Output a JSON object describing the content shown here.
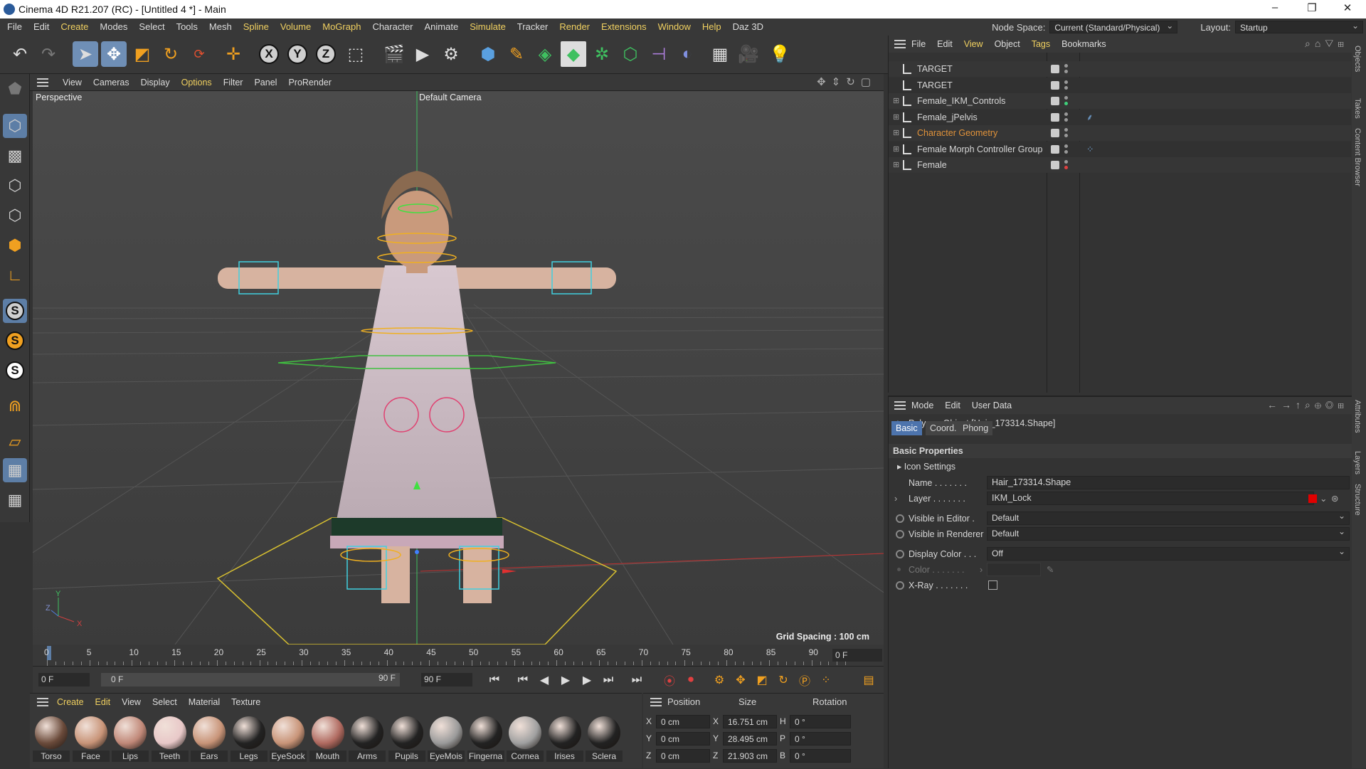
{
  "window": {
    "title": "Cinema 4D R21.207 (RC) - [Untitled 4 *] - Main",
    "min": "–",
    "max": "❐",
    "close": "✕"
  },
  "menu": [
    "File",
    "Edit",
    "Create",
    "Modes",
    "Select",
    "Tools",
    "Mesh",
    "Spline",
    "Volume",
    "MoGraph",
    "Character",
    "Animate",
    "Simulate",
    "Tracker",
    "Render",
    "Extensions",
    "Window",
    "Help",
    "Daz 3D"
  ],
  "menu_highlight": [
    "Create",
    "Spline",
    "Volume",
    "MoGraph",
    "Simulate",
    "Render",
    "Extensions",
    "Window",
    "Help"
  ],
  "node_space": {
    "label": "Node Space:",
    "value": "Current (Standard/Physical)"
  },
  "layout": {
    "label": "Layout:",
    "value": "Startup"
  },
  "viewport": {
    "menu": [
      "View",
      "Cameras",
      "Display",
      "Options",
      "Filter",
      "Panel",
      "ProRender"
    ],
    "active_menu": "Options",
    "name": "Perspective",
    "camera": "Default Camera",
    "grid_spacing": "Grid Spacing : 100 cm"
  },
  "timeline": {
    "ticks": [
      "0",
      "5",
      "10",
      "15",
      "20",
      "25",
      "30",
      "35",
      "40",
      "45",
      "50",
      "55",
      "60",
      "65",
      "70",
      "75",
      "80",
      "85",
      "90"
    ],
    "current_frame": "0 F"
  },
  "transport": {
    "start": "0 F",
    "range_start": "0 F",
    "range_end": "90 F",
    "end": "90 F"
  },
  "materials": {
    "menu": [
      "Create",
      "Edit",
      "View",
      "Select",
      "Material",
      "Texture"
    ],
    "items": [
      "Torso",
      "Face",
      "Lips",
      "Teeth",
      "Ears",
      "Legs",
      "EyeSock",
      "Mouth",
      "Arms",
      "Pupils",
      "EyeMois",
      "Fingerna",
      "Cornea",
      "Irises",
      "Sclera"
    ]
  },
  "coords": {
    "headers": [
      "Position",
      "Size",
      "Rotation"
    ],
    "rows": [
      {
        "axis": "X",
        "pos": "0 cm",
        "saxis": "X",
        "size": "16.751 cm",
        "raxis": "H",
        "rot": "0 °"
      },
      {
        "axis": "Y",
        "pos": "0 cm",
        "saxis": "Y",
        "size": "28.495 cm",
        "raxis": "P",
        "rot": "0 °"
      },
      {
        "axis": "Z",
        "pos": "0 cm",
        "saxis": "Z",
        "size": "21.903 cm",
        "raxis": "B",
        "rot": "0 °"
      }
    ]
  },
  "objects": {
    "menu": [
      "File",
      "Edit",
      "View",
      "Object",
      "Tags",
      "Bookmarks"
    ],
    "rows": [
      {
        "name": "TARGET",
        "color": "#d6d6d6",
        "dot": "#999"
      },
      {
        "name": "TARGET",
        "color": "#d6d6d6",
        "dot": "#999"
      },
      {
        "name": "Female_IKM_Controls",
        "color": "#d6d6d6",
        "dot": "#3fd07a"
      },
      {
        "name": "Female_jPelvis",
        "color": "#d6d6d6",
        "dot": "#999"
      },
      {
        "name": "Character Geometry",
        "color": "#e0923a",
        "dot": "#999"
      },
      {
        "name": "Female Morph Controller Group",
        "color": "#d6d6d6",
        "dot": "#999"
      },
      {
        "name": "Female",
        "color": "#d6d6d6",
        "dot": "#e04040"
      }
    ]
  },
  "attributes": {
    "menu": [
      "Mode",
      "Edit",
      "User Data"
    ],
    "object_title": "Polygon Object [Hair_173314.Shape]",
    "tabs": [
      "Basic",
      "Coord.",
      "Phong"
    ],
    "section": "Basic Properties",
    "icon_settings": "Icon Settings",
    "fields": {
      "name_label": "Name . . . . . . .",
      "name_value": "Hair_173314.Shape",
      "layer_label": "Layer . . . . . . .",
      "layer_value": "IKM_Lock",
      "vis_editor_label": "Visible in Editor .",
      "vis_editor_value": "Default",
      "vis_render_label": "Visible in Renderer",
      "vis_render_value": "Default",
      "display_color_label": "Display Color . . .",
      "display_color_value": "Off",
      "color_label": "Color . . . . . . .",
      "xray_label": "X-Ray . . . . . . ."
    }
  },
  "side_tabs": [
    "Objects",
    "Takes",
    "Content Browser",
    "Attributes",
    "Layers",
    "Structure"
  ]
}
